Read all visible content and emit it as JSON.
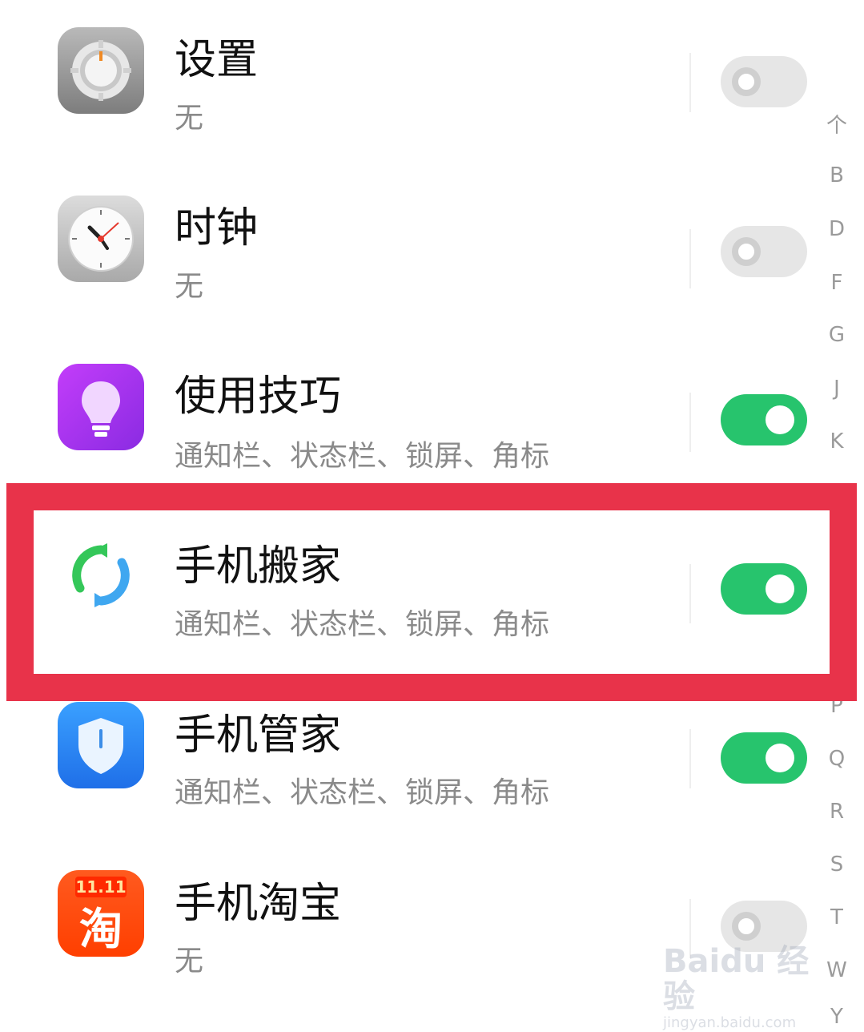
{
  "apps": [
    {
      "name": "设置",
      "desc": "无",
      "icon": "settings-gear-icon",
      "enabled": false
    },
    {
      "name": "时钟",
      "desc": "无",
      "icon": "clock-icon",
      "enabled": false
    },
    {
      "name": "使用技巧",
      "desc": "通知栏、状态栏、锁屏、角标",
      "icon": "lightbulb-icon",
      "enabled": true
    },
    {
      "name": "手机搬家",
      "desc": "通知栏、状态栏、锁屏、角标",
      "icon": "phone-clone-sync-icon",
      "enabled": true
    },
    {
      "name": "手机管家",
      "desc": "通知栏、状态栏、锁屏、角标",
      "icon": "shield-icon",
      "enabled": true
    },
    {
      "name": "手机淘宝",
      "desc": "无",
      "icon": "taobao-icon",
      "enabled": false,
      "icon_text": "11.11 淘"
    }
  ],
  "alpha_index": [
    "个",
    "B",
    "D",
    "F",
    "G",
    "J",
    "K",
    "P",
    "Q",
    "R",
    "S",
    "T",
    "W",
    "Y"
  ],
  "watermark": {
    "logo": "Baidu 经验",
    "url": "jingyan.baidu.com"
  },
  "colors": {
    "toggle_on": "#27c46d",
    "toggle_off": "#e6e6e6",
    "highlight": "#e8334a"
  }
}
